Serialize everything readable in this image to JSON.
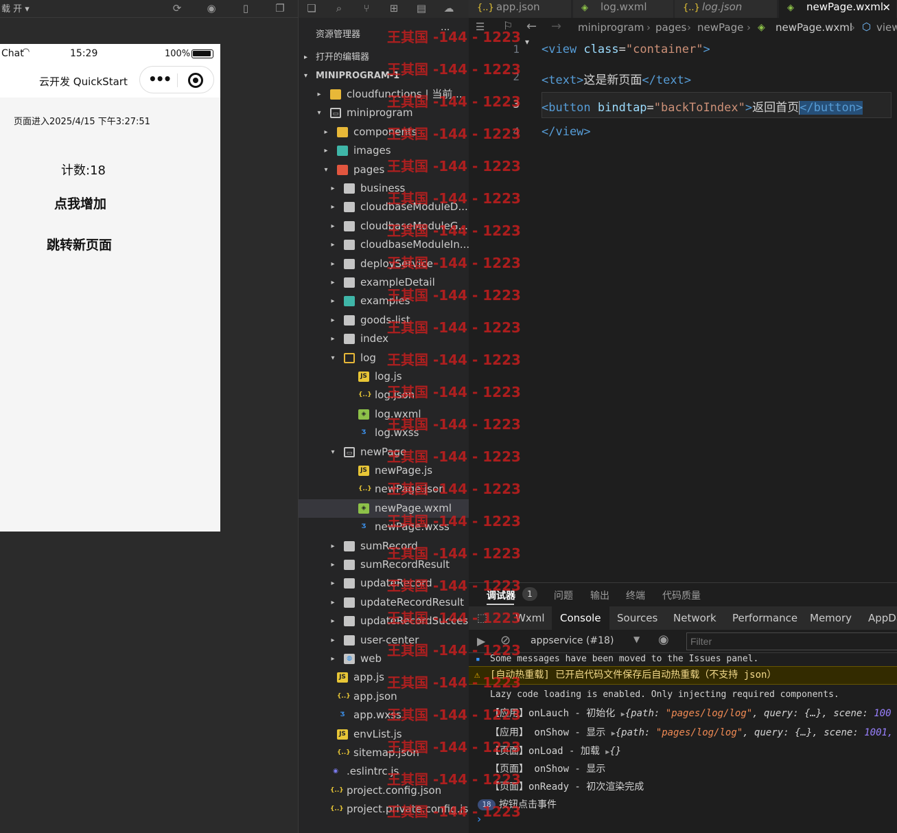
{
  "simulator": {
    "toolbar_label": "载 开 ▾",
    "status": {
      "carrier": "Chat",
      "time": "15:29",
      "battery": "100%"
    },
    "nav_title": "云开发 QuickStart",
    "capsule_dots": "•••",
    "enter_time": "页面进入2025/4/15 下午3:27:51",
    "count_label": "计数:18",
    "increment_button": "点我增加",
    "navigate_button": "跳转新页面"
  },
  "explorer": {
    "title": "资源管理器",
    "more": "···",
    "open_editors": "打开的编辑器",
    "root": "MINIPROGRAM-1",
    "items": [
      {
        "label": "cloudfunctions | 当前...",
        "depth": 0,
        "kind": "folder-yellow",
        "arrow": "▸"
      },
      {
        "label": "miniprogram",
        "depth": 0,
        "kind": "folder-open",
        "arrow": "▾"
      },
      {
        "label": "components",
        "depth": 1,
        "kind": "folder-yellow",
        "arrow": "▸"
      },
      {
        "label": "images",
        "depth": 1,
        "kind": "folder-teal",
        "arrow": "▸"
      },
      {
        "label": "pages",
        "depth": 1,
        "kind": "folder-red",
        "arrow": "▾"
      },
      {
        "label": "business",
        "depth": 2,
        "kind": "folder",
        "arrow": "▸"
      },
      {
        "label": "cloudbaseModuleD...",
        "depth": 2,
        "kind": "folder",
        "arrow": "▸"
      },
      {
        "label": "cloudbaseModuleG...",
        "depth": 2,
        "kind": "folder",
        "arrow": "▸"
      },
      {
        "label": "cloudbaseModuleIn...",
        "depth": 2,
        "kind": "folder",
        "arrow": "▸"
      },
      {
        "label": "deployService",
        "depth": 2,
        "kind": "folder",
        "arrow": "▸"
      },
      {
        "label": "exampleDetail",
        "depth": 2,
        "kind": "folder",
        "arrow": "▸"
      },
      {
        "label": "examples",
        "depth": 2,
        "kind": "folder-teal",
        "arrow": "▸"
      },
      {
        "label": "goods-list",
        "depth": 2,
        "kind": "folder",
        "arrow": "▸"
      },
      {
        "label": "index",
        "depth": 2,
        "kind": "folder",
        "arrow": "▸"
      },
      {
        "label": "log",
        "depth": 2,
        "kind": "folder-open-y",
        "arrow": "▾"
      },
      {
        "label": "log.js",
        "depth": 3,
        "kind": "js",
        "arrow": ""
      },
      {
        "label": "log.json",
        "depth": 3,
        "kind": "json",
        "arrow": ""
      },
      {
        "label": "log.wxml",
        "depth": 3,
        "kind": "wxml",
        "arrow": ""
      },
      {
        "label": "log.wxss",
        "depth": 3,
        "kind": "wxss",
        "arrow": ""
      },
      {
        "label": "newPage",
        "depth": 2,
        "kind": "folder-open",
        "arrow": "▾"
      },
      {
        "label": "newPage.js",
        "depth": 3,
        "kind": "js",
        "arrow": ""
      },
      {
        "label": "newPage.json",
        "depth": 3,
        "kind": "json",
        "arrow": ""
      },
      {
        "label": "newPage.wxml",
        "depth": 3,
        "kind": "wxml",
        "arrow": "",
        "selected": true
      },
      {
        "label": "newPage.wxss",
        "depth": 3,
        "kind": "wxss",
        "arrow": ""
      },
      {
        "label": "sumRecord",
        "depth": 2,
        "kind": "folder",
        "arrow": "▸"
      },
      {
        "label": "sumRecordResult",
        "depth": 2,
        "kind": "folder",
        "arrow": "▸"
      },
      {
        "label": "updateRecord",
        "depth": 2,
        "kind": "folder",
        "arrow": "▸"
      },
      {
        "label": "updateRecordResult",
        "depth": 2,
        "kind": "folder",
        "arrow": "▸"
      },
      {
        "label": "updateRecordSuccess",
        "depth": 2,
        "kind": "folder",
        "arrow": "▸"
      },
      {
        "label": "user-center",
        "depth": 2,
        "kind": "folder",
        "arrow": "▸"
      },
      {
        "label": "web",
        "depth": 2,
        "kind": "folder-web",
        "arrow": "▸"
      },
      {
        "label": "app.js",
        "depth": 1,
        "kind": "js",
        "arrow": ""
      },
      {
        "label": "app.json",
        "depth": 1,
        "kind": "json",
        "arrow": ""
      },
      {
        "label": "app.wxss",
        "depth": 1,
        "kind": "wxss",
        "arrow": ""
      },
      {
        "label": "envList.js",
        "depth": 1,
        "kind": "js",
        "arrow": ""
      },
      {
        "label": "sitemap.json",
        "depth": 1,
        "kind": "json",
        "arrow": ""
      },
      {
        "label": ".eslintrc.js",
        "depth": 0,
        "kind": "eslint",
        "arrow": ""
      },
      {
        "label": "project.config.json",
        "depth": 0,
        "kind": "json",
        "arrow": ""
      },
      {
        "label": "project.private.config.js...",
        "depth": 0,
        "kind": "json",
        "arrow": ""
      }
    ]
  },
  "editor": {
    "tabs": [
      {
        "label": "app.json",
        "icon": "{..}",
        "active": false,
        "italic": false
      },
      {
        "label": "log.wxml",
        "icon": "◈",
        "active": false,
        "italic": false
      },
      {
        "label": "log.json",
        "icon": "{..}",
        "active": false,
        "italic": true
      },
      {
        "label": "newPage.wxml",
        "icon": "◈",
        "active": true,
        "italic": false,
        "close": "✕"
      }
    ],
    "breadcrumb": [
      "miniprogram",
      "pages",
      "newPage",
      "newPage.wxml",
      "view"
    ],
    "line_numbers": [
      "1",
      "2",
      "3",
      "4"
    ],
    "code": {
      "l1_open": "<view ",
      "l1_attr": "class",
      "l1_eq": "=",
      "l1_val": "\"container\"",
      "l1_close": ">",
      "l2_open": "<text>",
      "l2_text": "这是新页面",
      "l2_close": "</text>",
      "l3_open": "<button ",
      "l3_attr": "bindtap",
      "l3_eq": "=",
      "l3_val": "\"backToIndex\"",
      "l3_gt": ">",
      "l3_text": "返回首页",
      "l3_close": "</button>",
      "l4": "</view>"
    }
  },
  "panel": {
    "tabs": [
      "调试器",
      "问题",
      "输出",
      "终端",
      "代码质量"
    ],
    "debugger_badge": "1",
    "devtools_tabs": [
      "Wxml",
      "Console",
      "Sources",
      "Network",
      "Performance",
      "Memory",
      "AppDa"
    ],
    "context": "appservice (#18)",
    "filter_placeholder": "Filter",
    "console": {
      "moved": "Some messages have been moved to the Issues panel.",
      "hot_reload": "[自动热重载] 已开启代码文件保存后自动热重载（不支持 json）",
      "lazy": "Lazy code loading is enabled. Only injecting required components.",
      "l1_prefix": "【应用】onLauch - 初始化 ",
      "l1_obj": "{path: ",
      "l1_path": "\"pages/log/log\"",
      "l1_rest": ", query: {…}, scene: ",
      "l1_scene": "100",
      "l2_prefix": "【应用】 onShow - 显示 ",
      "l2_obj": "{path: ",
      "l2_path": "\"pages/log/log\"",
      "l2_rest": ", query: {…}, scene: ",
      "l2_scene": "1001,",
      "l3": "【页面】onLoad - 加载 ",
      "l3_obj": "{}",
      "l4": "【页面】 onShow - 显示",
      "l5": "【页面】onReady - 初次渲染完成",
      "count_badge": "18",
      "l6": "按钮点击事件",
      "prompt": "›"
    }
  },
  "watermark": "王其国 -144 - 1223"
}
